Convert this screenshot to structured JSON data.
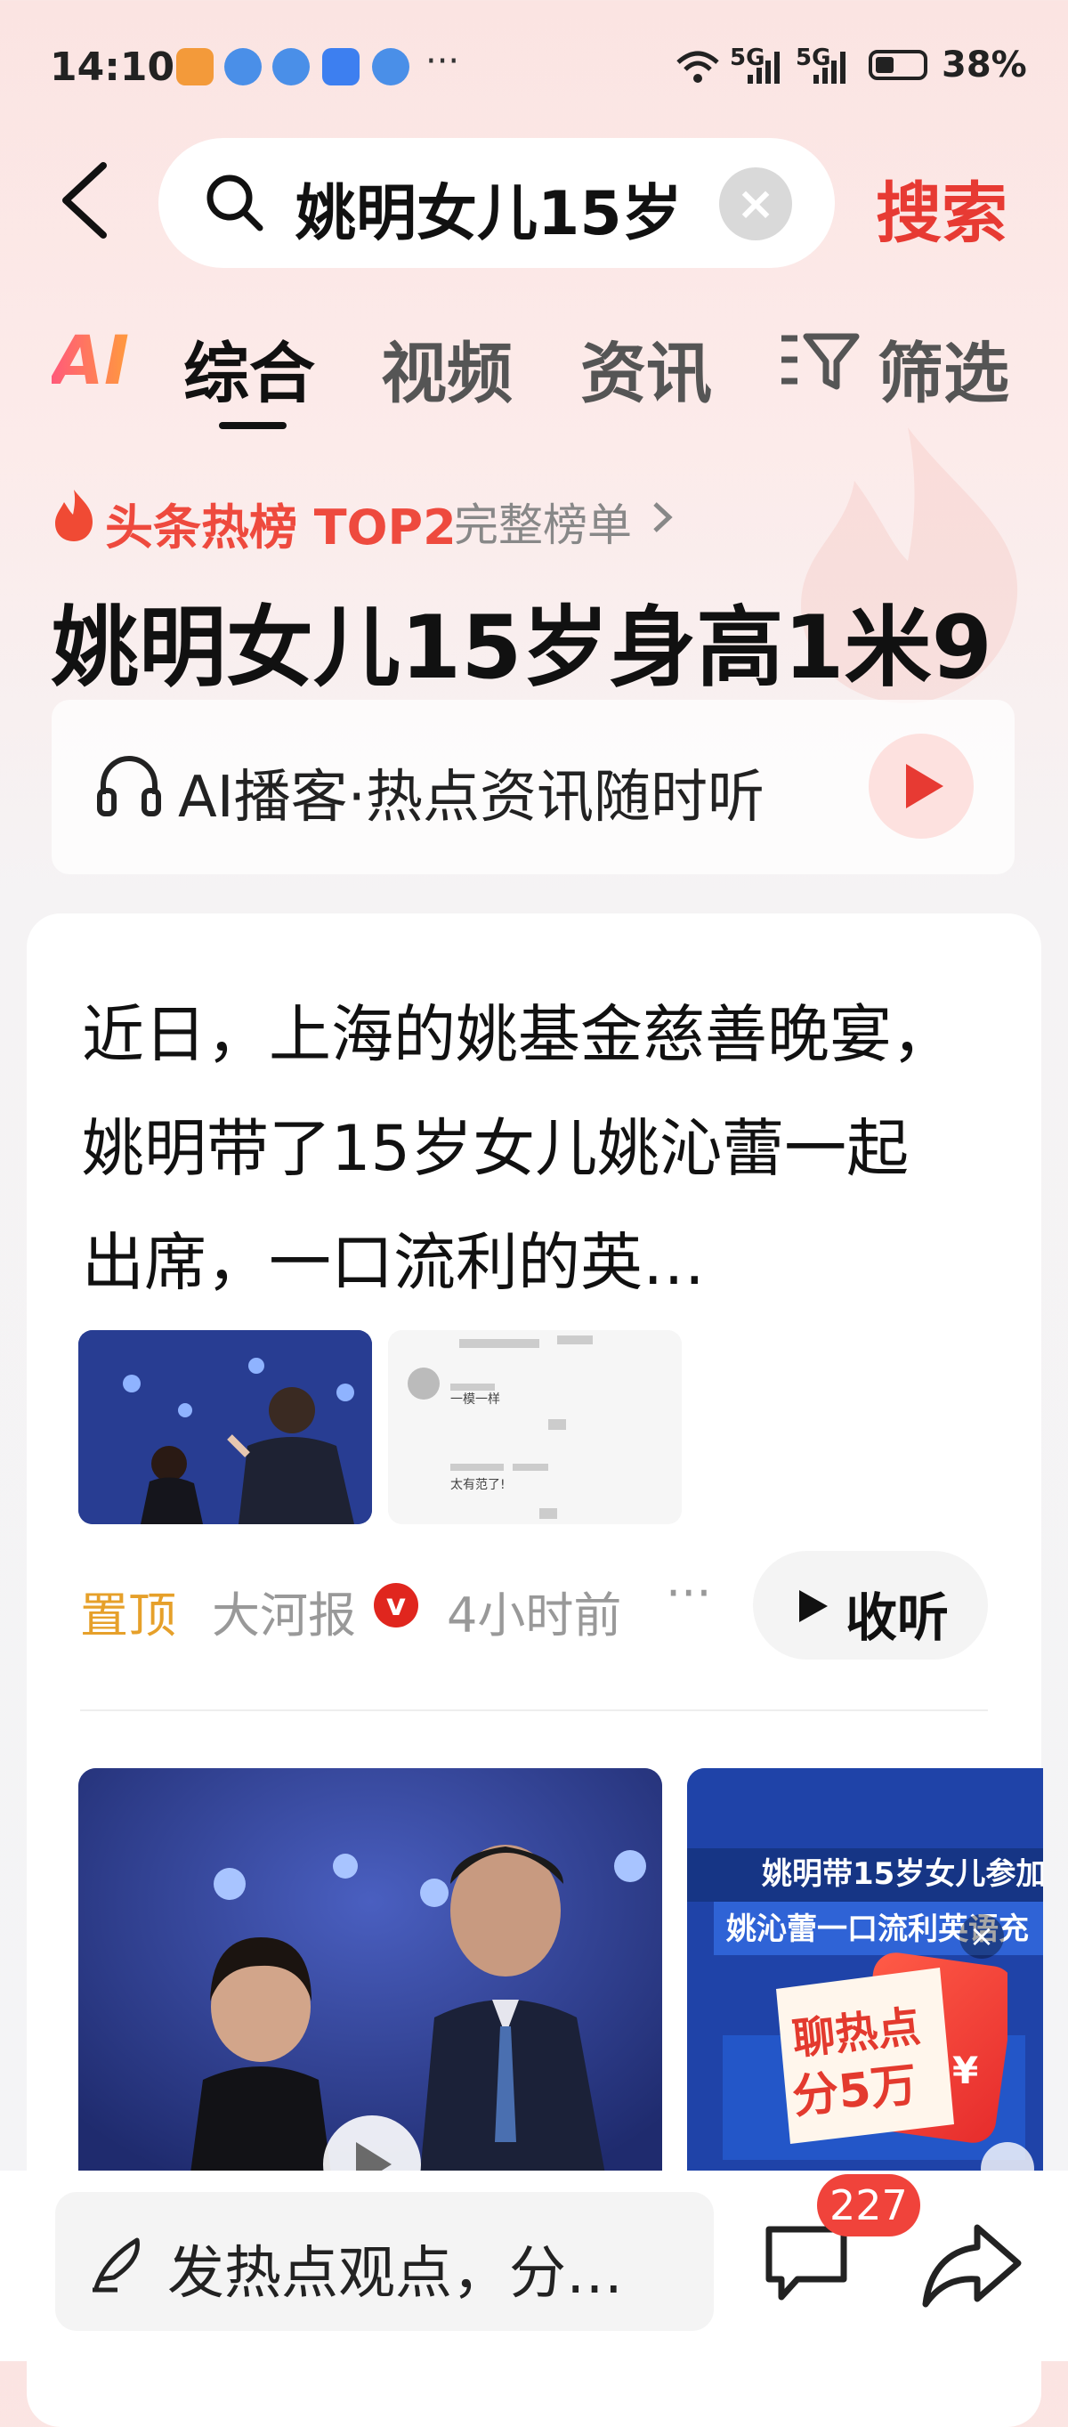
{
  "status_bar": {
    "time": "14:10",
    "net1": "5G",
    "net2": "5G",
    "battery": "38%"
  },
  "search": {
    "query": "姚明女儿15岁",
    "button_label": "搜索"
  },
  "tabs": [
    {
      "label": "AI"
    },
    {
      "label": "综合",
      "active": true
    },
    {
      "label": "视频"
    },
    {
      "label": "资讯"
    },
    {
      "label": "筛选"
    }
  ],
  "hot": {
    "label": "头条热榜 TOP2",
    "full_list": "完整榜单",
    "headline": "姚明女儿15岁身高1米9"
  },
  "podcast": {
    "text": "AI播客·热点资讯随时听"
  },
  "article": {
    "text": "近日，上海的姚基金慈善晚宴，姚明带了15岁女儿姚沁蕾一起出席，一口流利的英…",
    "pinned": "置顶",
    "source": "大河报",
    "verified": "v",
    "time_ago": "4小时前",
    "more": "···",
    "listen_label": "收听",
    "thumb2_lines": [
      "一模一样",
      "太有范了!"
    ]
  },
  "video2": {
    "caption1": "姚明带15岁女儿参加",
    "caption2": "姚沁蕾一口流利英语充"
  },
  "hot_chat": {
    "line1": "聊热点",
    "line2": "分5万",
    "currency": "¥",
    "close": "×"
  },
  "bottom": {
    "comment_placeholder": "发热点观点，分…",
    "comment_count": "227"
  },
  "colors": {
    "accent": "#e73a33",
    "pinned": "#e6a02a",
    "hot": "#ee4a3e"
  }
}
